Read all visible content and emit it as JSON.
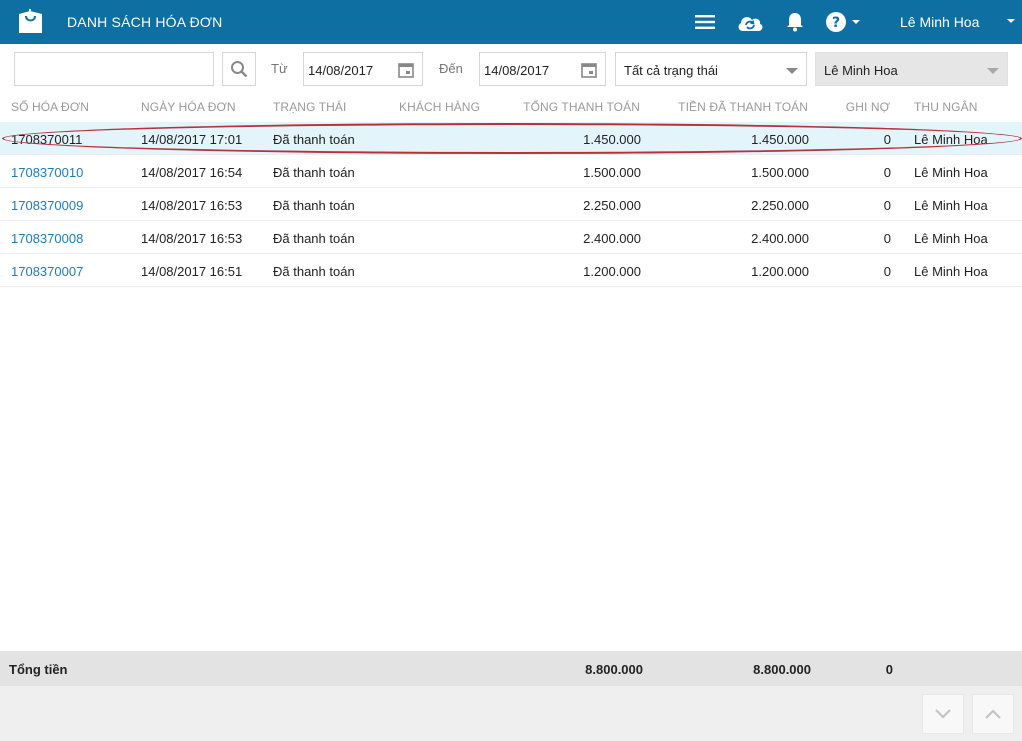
{
  "header": {
    "title": "DANH SÁCH HÓA ĐƠN",
    "user_name": "Lê Minh Hoa",
    "colors": {
      "bar": "#0e6fa3",
      "link": "#1a7dc0",
      "selected_row": "#e3f4fb"
    }
  },
  "filters": {
    "search_value": "",
    "from_label": "Từ",
    "from_date": "14/08/2017",
    "to_label": "Đến",
    "to_date": "14/08/2017",
    "status_value": "Tất cả trạng thái",
    "cashier_value": "Lê Minh Hoa"
  },
  "table": {
    "columns": [
      "SỐ HÓA ĐƠN",
      "NGÀY HÓA ĐƠN",
      "TRẠNG THÁI",
      "KHÁCH HÀNG",
      "TỔNG THANH TOÁN",
      "TIỀN ĐÃ THANH TOÁN",
      "GHI NỢ",
      "THU NGÂN"
    ],
    "rows": [
      {
        "number": "1708370011",
        "date": "14/08/2017 17:01",
        "status": "Đã thanh toán",
        "customer": "",
        "total": "1.450.000",
        "paid": "1.450.000",
        "debt": "0",
        "cashier": "Lê Minh Hoa"
      },
      {
        "number": "1708370010",
        "date": "14/08/2017 16:54",
        "status": "Đã thanh toán",
        "customer": "",
        "total": "1.500.000",
        "paid": "1.500.000",
        "debt": "0",
        "cashier": "Lê Minh Hoa"
      },
      {
        "number": "1708370009",
        "date": "14/08/2017 16:53",
        "status": "Đã thanh toán",
        "customer": "",
        "total": "2.250.000",
        "paid": "2.250.000",
        "debt": "0",
        "cashier": "Lê Minh Hoa"
      },
      {
        "number": "1708370008",
        "date": "14/08/2017 16:53",
        "status": "Đã thanh toán",
        "customer": "",
        "total": "2.400.000",
        "paid": "2.400.000",
        "debt": "0",
        "cashier": "Lê Minh Hoa"
      },
      {
        "number": "1708370007",
        "date": "14/08/2017 16:51",
        "status": "Đã thanh toán",
        "customer": "",
        "total": "1.200.000",
        "paid": "1.200.000",
        "debt": "0",
        "cashier": "Lê Minh Hoa"
      }
    ]
  },
  "totals": {
    "label": "Tổng tiền",
    "total": "8.800.000",
    "paid": "8.800.000",
    "debt": "0"
  },
  "icons": [
    "store-bag-icon",
    "hamburger-menu-icon",
    "cloud-sync-icon",
    "bell-icon",
    "help-icon",
    "search-icon",
    "calendar-icon",
    "chevron-down-icon",
    "chevron-up-icon"
  ]
}
